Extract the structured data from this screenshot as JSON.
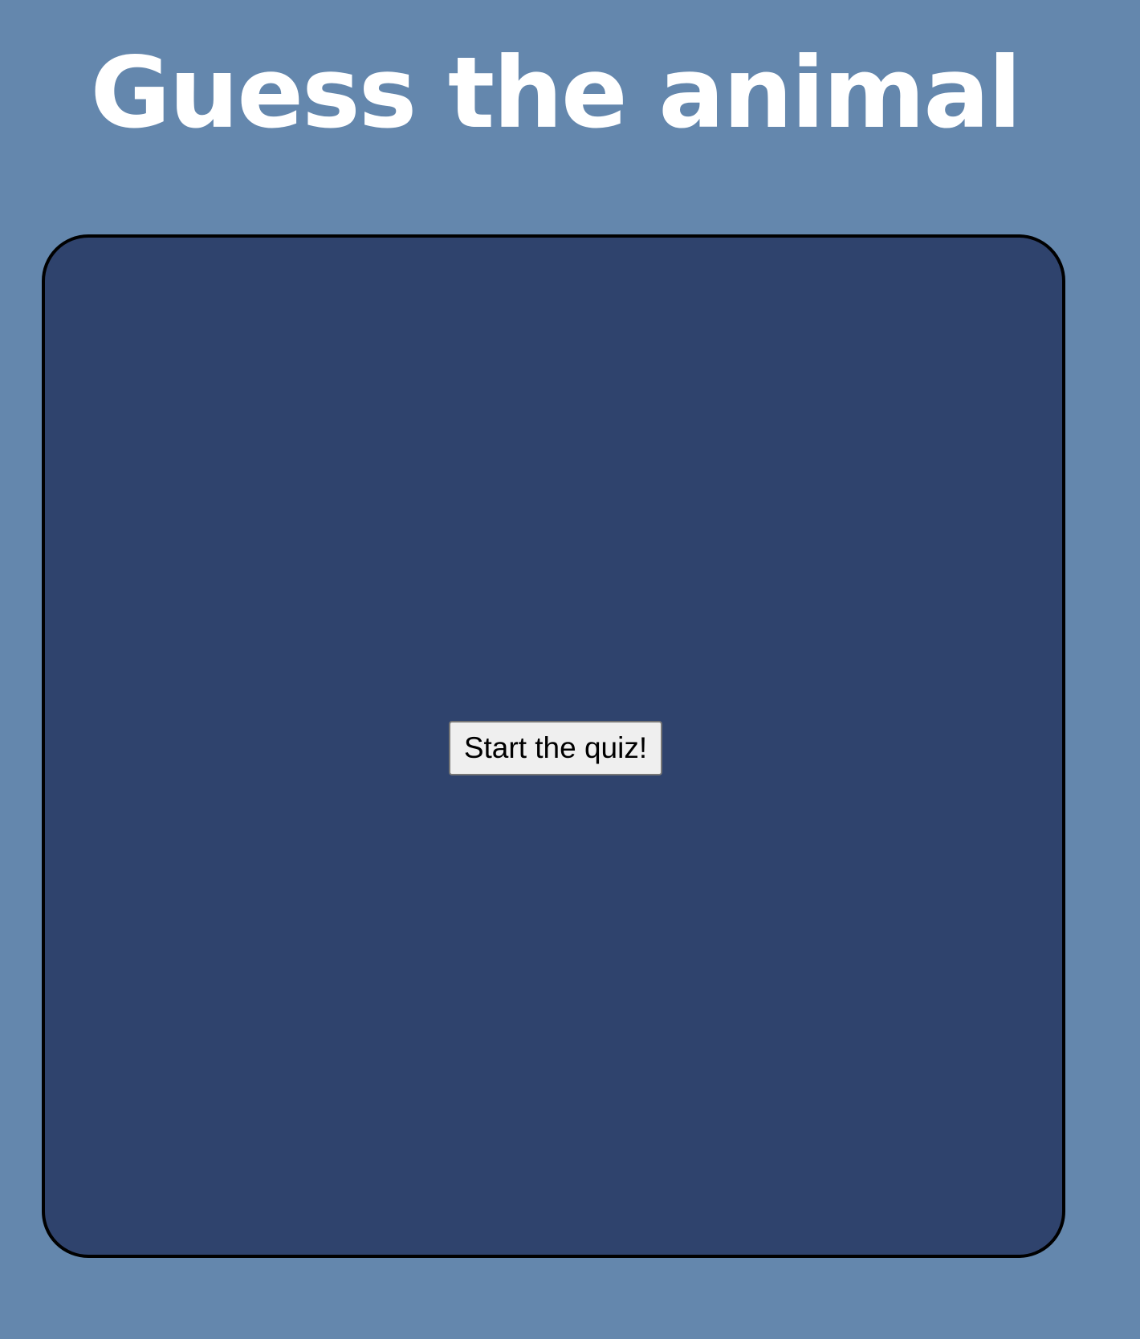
{
  "header": {
    "title": "Guess the animal"
  },
  "quiz": {
    "start_label": "Start the quiz!"
  },
  "colors": {
    "page_background": "#6487ad",
    "panel_background": "#2f436d",
    "panel_border": "#000000",
    "title_text": "#ffffff",
    "button_background": "#efefef"
  }
}
